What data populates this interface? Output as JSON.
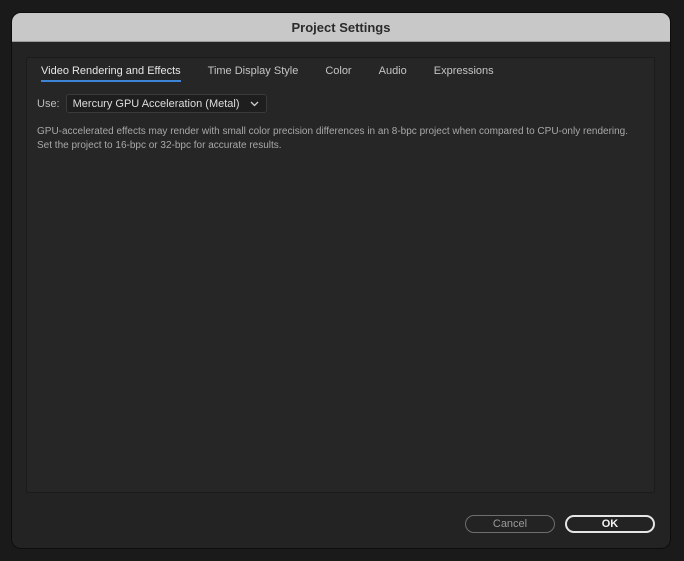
{
  "window": {
    "title": "Project Settings"
  },
  "tabs": [
    {
      "label": "Video Rendering and Effects",
      "active": true
    },
    {
      "label": "Time Display Style",
      "active": false
    },
    {
      "label": "Color",
      "active": false
    },
    {
      "label": "Audio",
      "active": false
    },
    {
      "label": "Expressions",
      "active": false
    }
  ],
  "use_field": {
    "label": "Use:",
    "selected": "Mercury GPU Acceleration (Metal)",
    "icon": "chevron-down-icon"
  },
  "note": {
    "line1": "GPU-accelerated effects may render with small color precision differences in an 8-bpc project when compared to CPU-only rendering.",
    "line2": "Set the project to 16-bpc or 32-bpc for accurate results."
  },
  "buttons": {
    "cancel": "Cancel",
    "ok": "OK"
  },
  "colors": {
    "accent": "#3b84d6",
    "titlebar": "#c8c8c8",
    "dialog_bg": "#232323"
  }
}
